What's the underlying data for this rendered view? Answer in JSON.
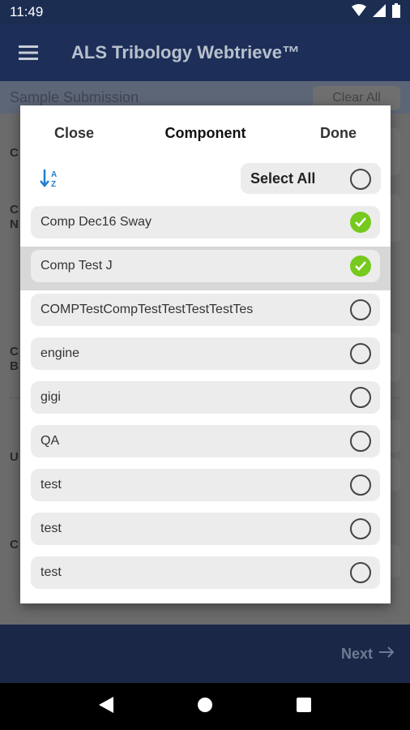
{
  "status_bar": {
    "time": "11:49"
  },
  "app_bar": {
    "title": "ALS Tribology Webtrieve™"
  },
  "background": {
    "sub_header": "Sample Submission",
    "clear_all": "Clear All",
    "fragments": [
      "C",
      "C",
      "N",
      "C",
      "B",
      "U",
      "C"
    ]
  },
  "bottom_bar": {
    "next_label": "Next"
  },
  "modal": {
    "close_label": "Close",
    "title": "Component",
    "done_label": "Done",
    "select_all_label": "Select All",
    "select_all_checked": false,
    "items": [
      {
        "label": "Comp Dec16 Sway",
        "checked": true
      },
      {
        "label": "Comp Test J",
        "checked": true
      },
      {
        "label": "COMPTestCompTestTestTestTestTes",
        "checked": false
      },
      {
        "label": "engine",
        "checked": false
      },
      {
        "label": "gigi",
        "checked": false
      },
      {
        "label": "QA",
        "checked": false
      },
      {
        "label": "test",
        "checked": false
      },
      {
        "label": "test",
        "checked": false
      },
      {
        "label": "test",
        "checked": false
      }
    ],
    "highlighted_index": 1
  },
  "colors": {
    "app_bar": "#1d2f58",
    "check_green": "#76c91d",
    "accent_blue": "#1f7fd1"
  }
}
